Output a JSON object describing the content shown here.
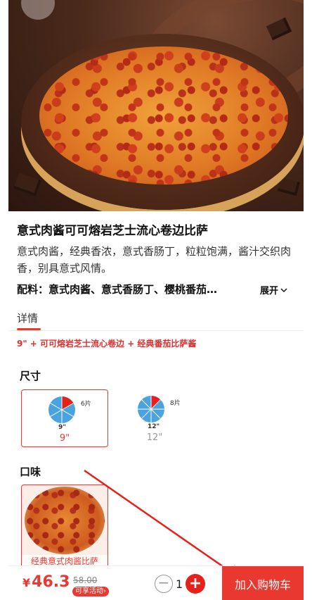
{
  "product": {
    "title": "意式肉酱可可熔岩芝士流心卷边比萨",
    "description": "意式肉酱，经典香浓，意式香肠丁，粒粒饱满，酱汁交织肉香，别具意式风情。",
    "ingredients": "配料：意式肉酱、意式香肠丁、樱桃番茄…",
    "expand_label": "展开",
    "spec_summary": "9\" + 可可熔岩芝士流心卷边 + 经典番茄比萨酱"
  },
  "tabs": [
    {
      "label": "详情",
      "active": true
    }
  ],
  "size_section": {
    "title": "尺寸",
    "options": [
      {
        "slices": "6片",
        "inch": "9\"",
        "label": "9\"",
        "selected": true
      },
      {
        "slices": "8片",
        "inch": "12\"",
        "label": "12\"",
        "selected": false
      }
    ]
  },
  "flavor_section": {
    "title": "口味",
    "options": [
      {
        "label": "经典意式肉酱比萨",
        "selected": true
      }
    ]
  },
  "bottom_bar": {
    "currency": "¥",
    "price": "46.3",
    "original_price": "58.00",
    "promo_label": "可享活动",
    "quantity": "1",
    "add_to_cart_label": "加入购物车"
  },
  "colors": {
    "accent": "#e83a32",
    "pie_blue": "#4aa3df",
    "pie_red": "#e8201a"
  }
}
